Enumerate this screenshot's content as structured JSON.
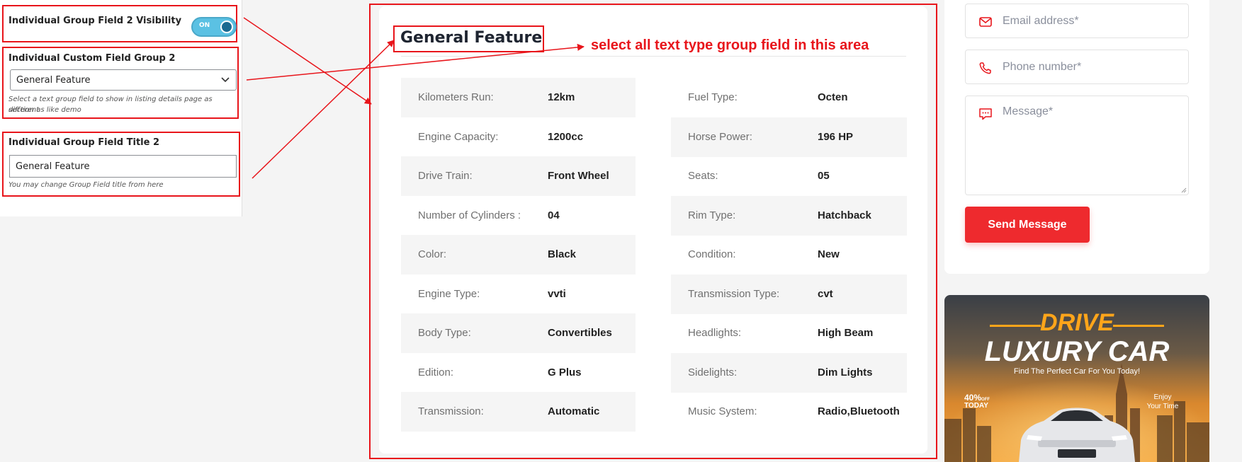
{
  "settings": {
    "visibility": {
      "label": "Individual Group Field 2 Visibility",
      "toggle_text": "ON"
    },
    "group": {
      "label": "Individual Custom Field Group 2",
      "selected": "General Feature",
      "description_line1": "Select a text group field to show in listing details page as different",
      "description_line2": "section as like demo"
    },
    "title_field": {
      "label": "Individual Group Field Title 2",
      "value": "General Feature",
      "description": "You may change Group Field title from here"
    }
  },
  "feature": {
    "title": "General Feature",
    "annotation": "select all text type group field in this area",
    "left_rows": [
      {
        "label": "Kilometers Run:",
        "value": "12km"
      },
      {
        "label": "Engine Capacity:",
        "value": "1200cc"
      },
      {
        "label": "Drive Train:",
        "value": "Front Wheel"
      },
      {
        "label": "Number of Cylinders :",
        "value": "04"
      },
      {
        "label": "Color:",
        "value": "Black"
      },
      {
        "label": "Engine Type:",
        "value": "vvti"
      },
      {
        "label": "Body Type:",
        "value": "Convertibles"
      },
      {
        "label": "Edition:",
        "value": "G Plus"
      },
      {
        "label": "Transmission:",
        "value": "Automatic"
      }
    ],
    "right_rows": [
      {
        "label": "Fuel Type:",
        "value": "Octen"
      },
      {
        "label": "Horse Power:",
        "value": "196 HP"
      },
      {
        "label": "Seats:",
        "value": "05"
      },
      {
        "label": "Rim Type:",
        "value": "Hatchback"
      },
      {
        "label": "Condition:",
        "value": "New"
      },
      {
        "label": "Transmission Type:",
        "value": "cvt"
      },
      {
        "label": "Headlights:",
        "value": "High Beam"
      },
      {
        "label": "Sidelights:",
        "value": "Dim Lights"
      },
      {
        "label": "Music System:",
        "value": "Radio,Bluetooth"
      }
    ]
  },
  "contact": {
    "email_placeholder": "Email address*",
    "phone_placeholder": "Phone number*",
    "message_placeholder": "Message*",
    "send_label": "Send Message",
    "email_icon": "envelope-icon",
    "phone_icon": "phone-icon",
    "message_icon": "chat-icon"
  },
  "ad": {
    "line1": "DRIVE",
    "line2": "LUXURY CAR",
    "tagline": "Find The Perfect Car For You Today!",
    "percent": "40%",
    "percent_suffix": "OFF",
    "today": "TODAY",
    "enjoy_line1": "Enjoy",
    "enjoy_line2": "Your Time"
  },
  "colors": {
    "annotation_red": "#e8151b",
    "toggle_on": "#5bc1e3",
    "send_button": "#ee2a2e",
    "row_shade": "#f5f5f5",
    "accent_orange": "#ffa51a"
  }
}
